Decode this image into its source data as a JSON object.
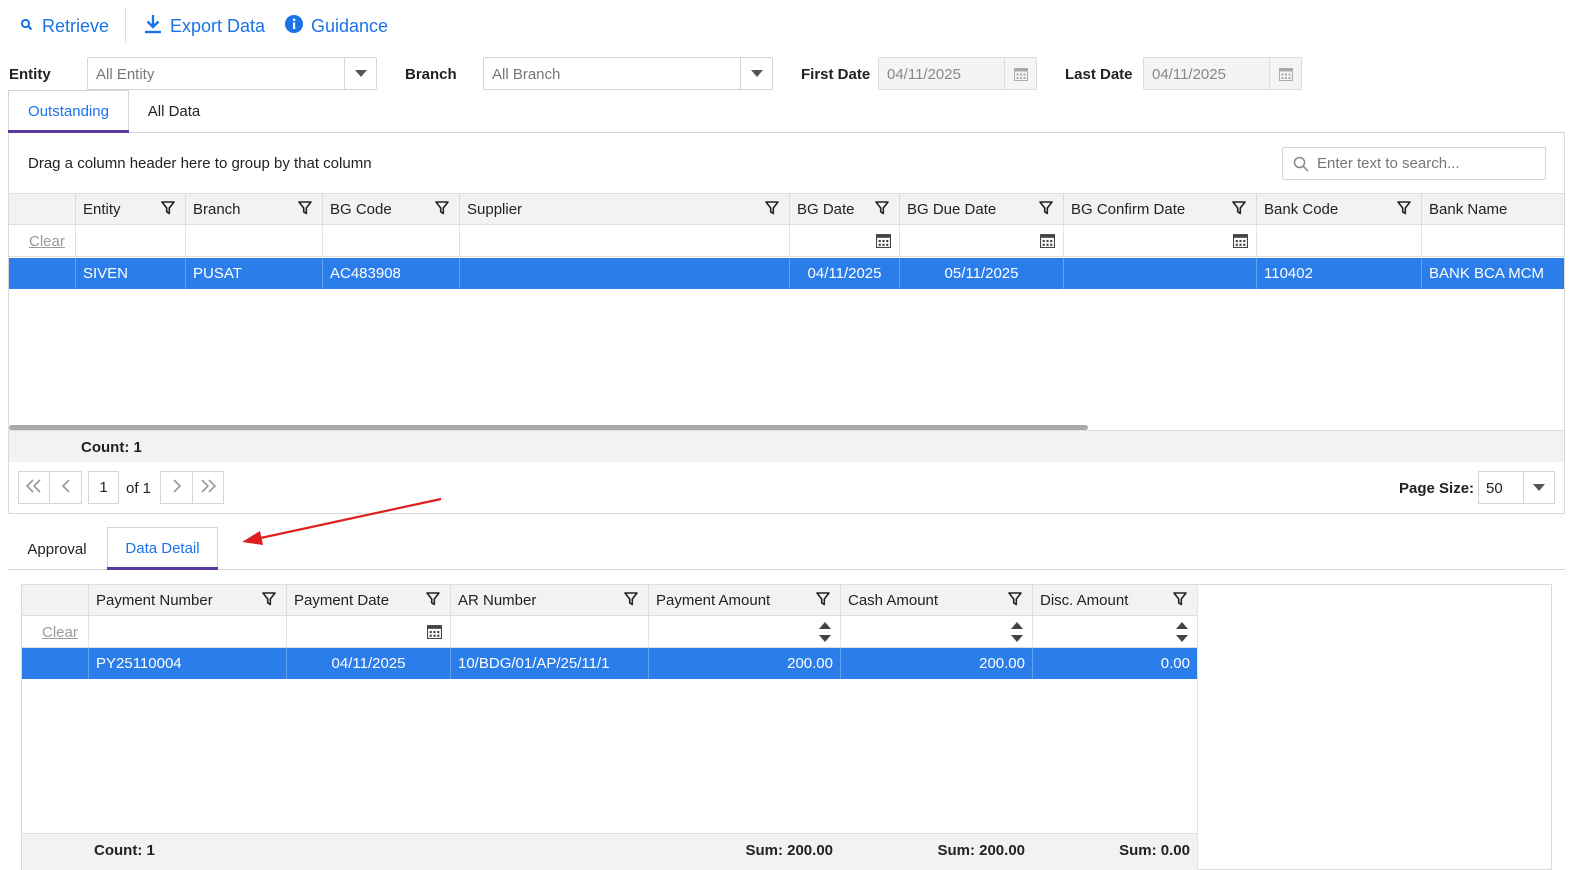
{
  "toolbar": {
    "retrieve": "Retrieve",
    "export": "Export Data",
    "guidance": "Guidance"
  },
  "filters": {
    "entity_label": "Entity",
    "entity_value": "All Entity",
    "branch_label": "Branch",
    "branch_value": "All Branch",
    "first_date_label": "First Date",
    "first_date_value": "04/11/2025",
    "last_date_label": "Last Date",
    "last_date_value": "04/11/2025"
  },
  "tabs_top": [
    "Outstanding",
    "All Data"
  ],
  "grid1": {
    "group_hint": "Drag a column header here to group by that column",
    "search_placeholder": "Enter text to search...",
    "clear": "Clear",
    "columns": [
      "Entity",
      "Branch",
      "BG Code",
      "Supplier",
      "BG Date",
      "BG Due Date",
      "BG Confirm Date",
      "Bank Code",
      "Bank Name"
    ],
    "row": {
      "entity": "SIVEN",
      "branch": "PUSAT",
      "bg_code": "AC483908",
      "supplier": "",
      "bg_date": "04/11/2025",
      "bg_due_date": "05/11/2025",
      "bg_confirm_date": "",
      "bank_code": "110402",
      "bank_name": "BANK BCA MCM"
    },
    "count": "Count: 1",
    "pager": {
      "page": "1",
      "of": "of 1",
      "page_size_label": "Page Size:",
      "page_size": "50"
    }
  },
  "tabs_bottom": [
    "Approval",
    "Data Detail"
  ],
  "grid2": {
    "clear": "Clear",
    "columns": [
      "Payment Number",
      "Payment Date",
      "AR Number",
      "Payment Amount",
      "Cash Amount",
      "Disc. Amount"
    ],
    "row": {
      "payment_number": "PY25110004",
      "payment_date": "04/11/2025",
      "ar_number": "10/BDG/01/AP/25/11/1",
      "payment_amount": "200.00",
      "cash_amount": "200.00",
      "disc_amount": "0.00"
    },
    "count": "Count: 1",
    "sum_payment": "Sum: 200.00",
    "sum_cash": "Sum: 200.00",
    "sum_disc": "Sum: 0.00"
  },
  "colors": {
    "accent": "#1a73e8",
    "selected_row": "#2b7de9",
    "tab_underline": "#5b3b9e",
    "annotation_arrow": "#e02020"
  }
}
